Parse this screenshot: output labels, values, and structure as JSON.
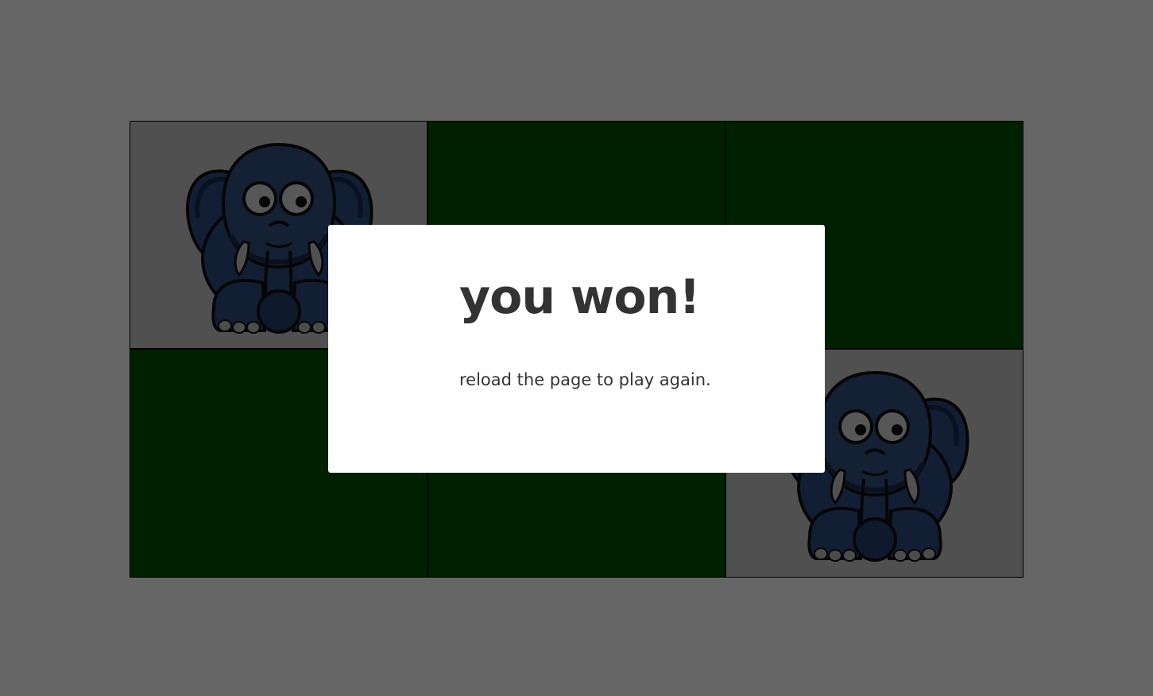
{
  "board": {
    "rows": 2,
    "columns": 3,
    "cards": [
      {
        "state": "face-up",
        "image": "elephant"
      },
      {
        "state": "face-down",
        "image": ""
      },
      {
        "state": "face-down",
        "image": ""
      },
      {
        "state": "face-down",
        "image": ""
      },
      {
        "state": "face-down",
        "image": ""
      },
      {
        "state": "face-up",
        "image": "elephant"
      }
    ]
  },
  "colors": {
    "card_back": "#005400",
    "card_front": "#c9c9c9",
    "overlay": "rgba(0,0,0,0.6)",
    "elephant_body": "#2f4b80",
    "modal_text": "#333333"
  },
  "modal": {
    "title": "you won!",
    "message": "reload the page to play again."
  }
}
